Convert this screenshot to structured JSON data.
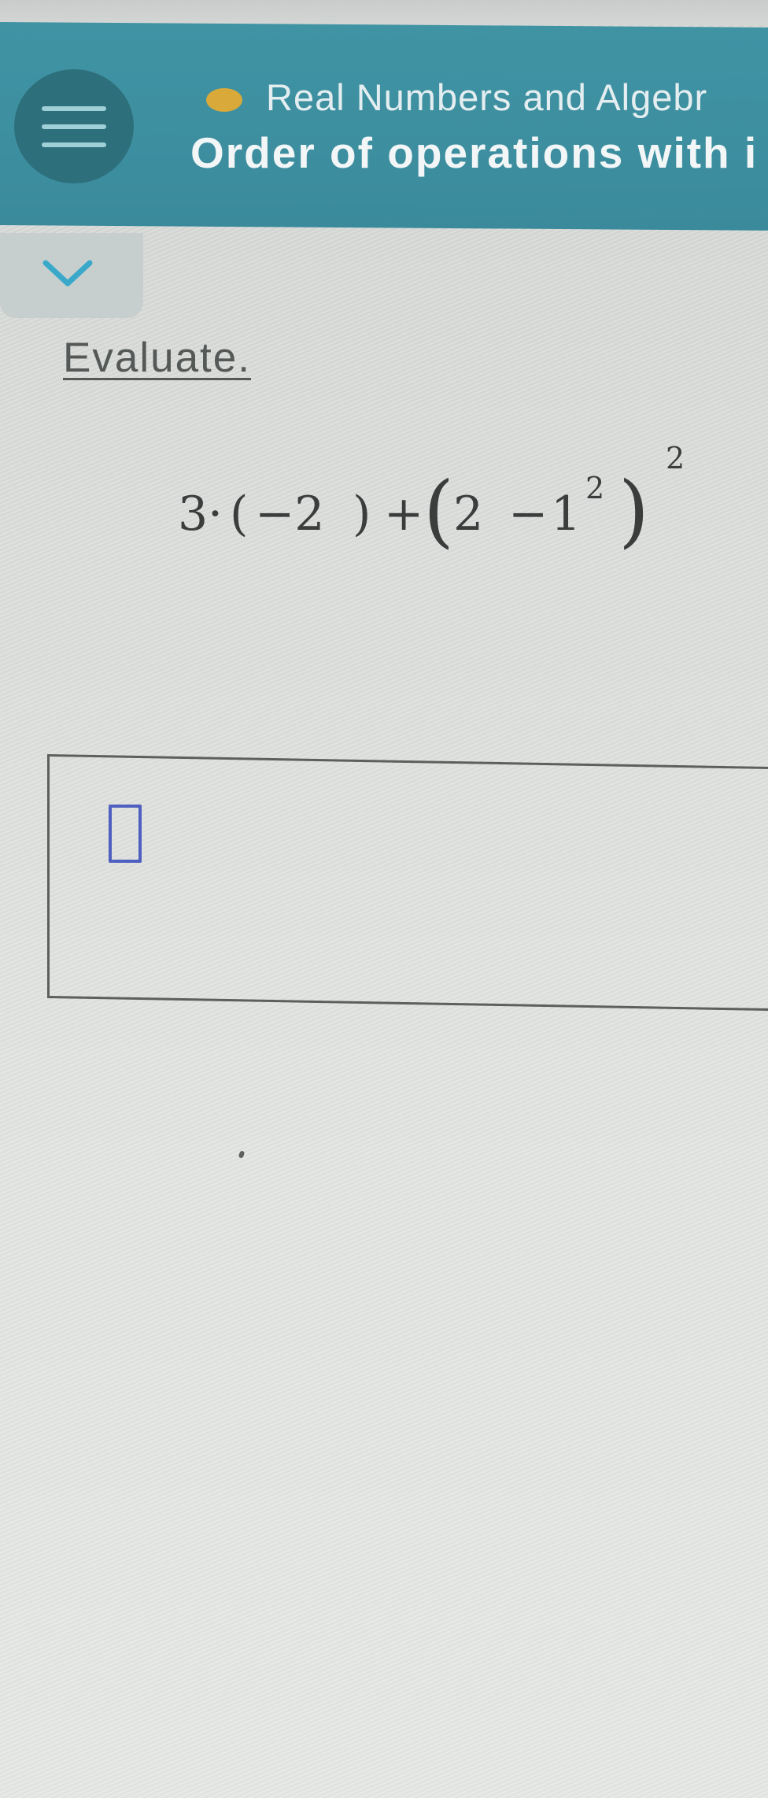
{
  "header": {
    "topic": "Real Numbers and Algebr",
    "lesson_title": "Order of operations with i",
    "menu_icon": "hamburger-menu-icon",
    "status_dot_color": "#d9a93a",
    "accent_color": "#3f93a3"
  },
  "collapse": {
    "icon": "chevron-down-icon",
    "icon_color": "#3aa9c9"
  },
  "problem": {
    "instruction": "Evaluate.",
    "expression": {
      "coef": "3",
      "dot": "·",
      "open1": "(",
      "neg": "−2",
      "close1": ")",
      "plus": "+",
      "open2": "(",
      "two": "2",
      "minus": "−",
      "one": "1",
      "inner_exp": "2",
      "close2": ")",
      "outer_exp": "2"
    }
  },
  "answer": {
    "value": "",
    "input_border_color": "#4f5fbf"
  }
}
